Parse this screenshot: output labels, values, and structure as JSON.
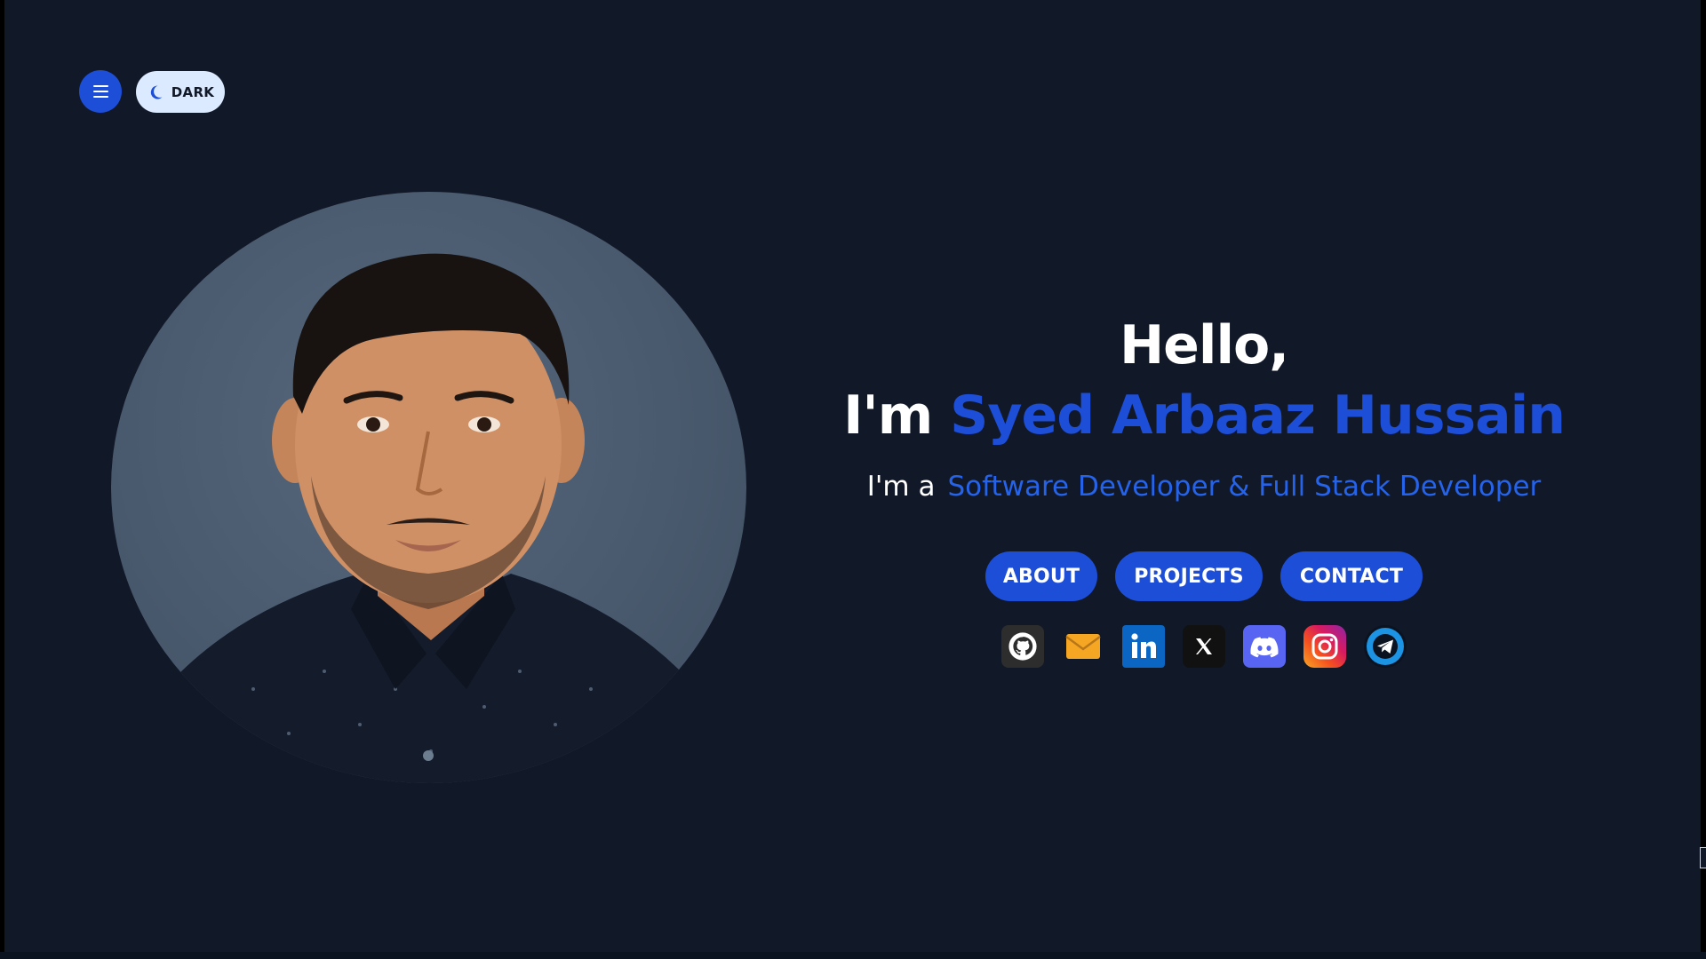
{
  "topbar": {
    "theme_label": "DARK"
  },
  "hero": {
    "greeting": "Hello,",
    "intro_prefix": "I'm",
    "name": "Syed Arbaaz Hussain",
    "role_prefix": "I'm a",
    "role": "Software Developer & Full Stack Developer"
  },
  "buttons": {
    "about": "ABOUT",
    "projects": "PROJECTS",
    "contact": "CONTACT"
  },
  "social": [
    {
      "icon": "github-icon"
    },
    {
      "icon": "email-icon"
    },
    {
      "icon": "linkedin-icon"
    },
    {
      "icon": "x-icon"
    },
    {
      "icon": "discord-icon"
    },
    {
      "icon": "instagram-icon"
    },
    {
      "icon": "telegram-icon"
    }
  ],
  "colors": {
    "background": "#111827",
    "accent": "#1d4ed8",
    "text": "#ffffff"
  }
}
